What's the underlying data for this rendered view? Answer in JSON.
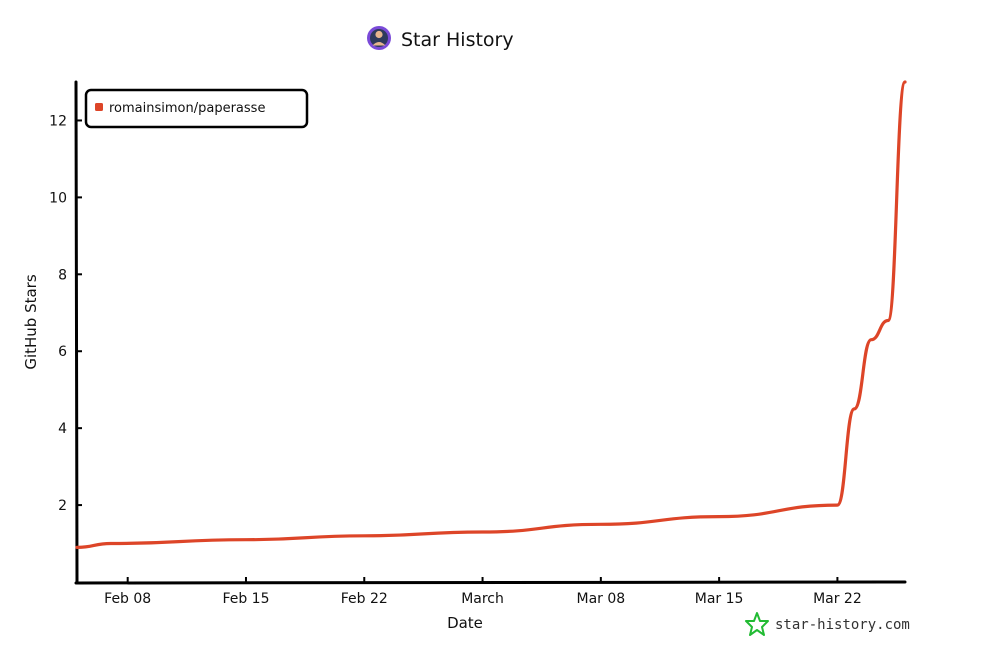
{
  "chart_data": {
    "type": "line",
    "title": "Star History",
    "xlabel": "Date",
    "ylabel": "GitHub Stars",
    "x_type": "date",
    "xlim": [
      "2023-02-05",
      "2023-03-26"
    ],
    "ylim": [
      0,
      13
    ],
    "x_ticks": [
      {
        "date": "2023-02-08",
        "label": "Feb 08"
      },
      {
        "date": "2023-02-15",
        "label": "Feb 15"
      },
      {
        "date": "2023-02-22",
        "label": "Feb 22"
      },
      {
        "date": "2023-03-01",
        "label": "March"
      },
      {
        "date": "2023-03-08",
        "label": "Mar 08"
      },
      {
        "date": "2023-03-15",
        "label": "Mar 15"
      },
      {
        "date": "2023-03-22",
        "label": "Mar 22"
      }
    ],
    "y_ticks": [
      2,
      4,
      6,
      8,
      10,
      12
    ],
    "grid": false,
    "legend_position": "top-left",
    "series": [
      {
        "name": "romainsimon/paperasse",
        "color": "#dd4528",
        "points": [
          {
            "x": "2023-02-05",
            "y": 0.9
          },
          {
            "x": "2023-02-07",
            "y": 1.0
          },
          {
            "x": "2023-02-15",
            "y": 1.1
          },
          {
            "x": "2023-02-22",
            "y": 1.2
          },
          {
            "x": "2023-03-01",
            "y": 1.3
          },
          {
            "x": "2023-03-08",
            "y": 1.5
          },
          {
            "x": "2023-03-15",
            "y": 1.7
          },
          {
            "x": "2023-03-22",
            "y": 2.0
          },
          {
            "x": "2023-03-23",
            "y": 4.5
          },
          {
            "x": "2023-03-24",
            "y": 6.3
          },
          {
            "x": "2023-03-25",
            "y": 6.8
          },
          {
            "x": "2023-03-26",
            "y": 13.0
          }
        ]
      }
    ]
  },
  "watermark": {
    "text": "star-history.com",
    "icon": "star-outline-icon",
    "icon_color": "#22bb33"
  },
  "avatar": {
    "icon": "user-avatar-icon"
  }
}
